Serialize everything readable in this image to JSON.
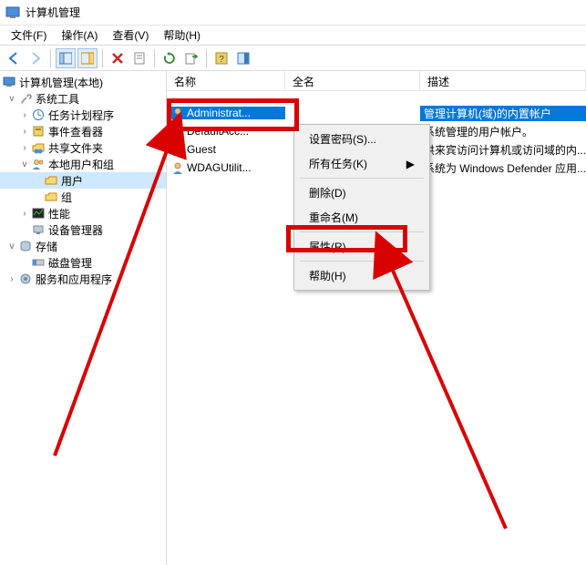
{
  "title": "计算机管理",
  "menus": {
    "file": "文件(F)",
    "action": "操作(A)",
    "view": "查看(V)",
    "help": "帮助(H)"
  },
  "tree": {
    "root": "计算机管理(本地)",
    "system_tools": "系统工具",
    "task_scheduler": "任务计划程序",
    "event_viewer": "事件查看器",
    "shared_folders": "共享文件夹",
    "local_users_groups": "本地用户和组",
    "users": "用户",
    "groups": "组",
    "performance": "性能",
    "device_manager": "设备管理器",
    "storage": "存储",
    "disk_management": "磁盘管理",
    "services_apps": "服务和应用程序"
  },
  "columns": {
    "name": "名称",
    "fullname": "全名",
    "desc": "描述"
  },
  "users": [
    {
      "name": "Administrat...",
      "full": "",
      "desc": "管理计算机(域)的内置帐户"
    },
    {
      "name": "DefaultAcc...",
      "full": "",
      "desc": "系统管理的用户帐户。"
    },
    {
      "name": "Guest",
      "full": "",
      "desc": "供来宾访问计算机或访问域的内..."
    },
    {
      "name": "WDAGUtilit...",
      "full": "",
      "desc": "系统为 Windows Defender 应用..."
    }
  ],
  "context_menu": {
    "set_password": "设置密码(S)...",
    "all_tasks": "所有任务(K)",
    "delete": "删除(D)",
    "rename": "重命名(M)",
    "properties": "属性(R)",
    "help": "帮助(H)"
  }
}
